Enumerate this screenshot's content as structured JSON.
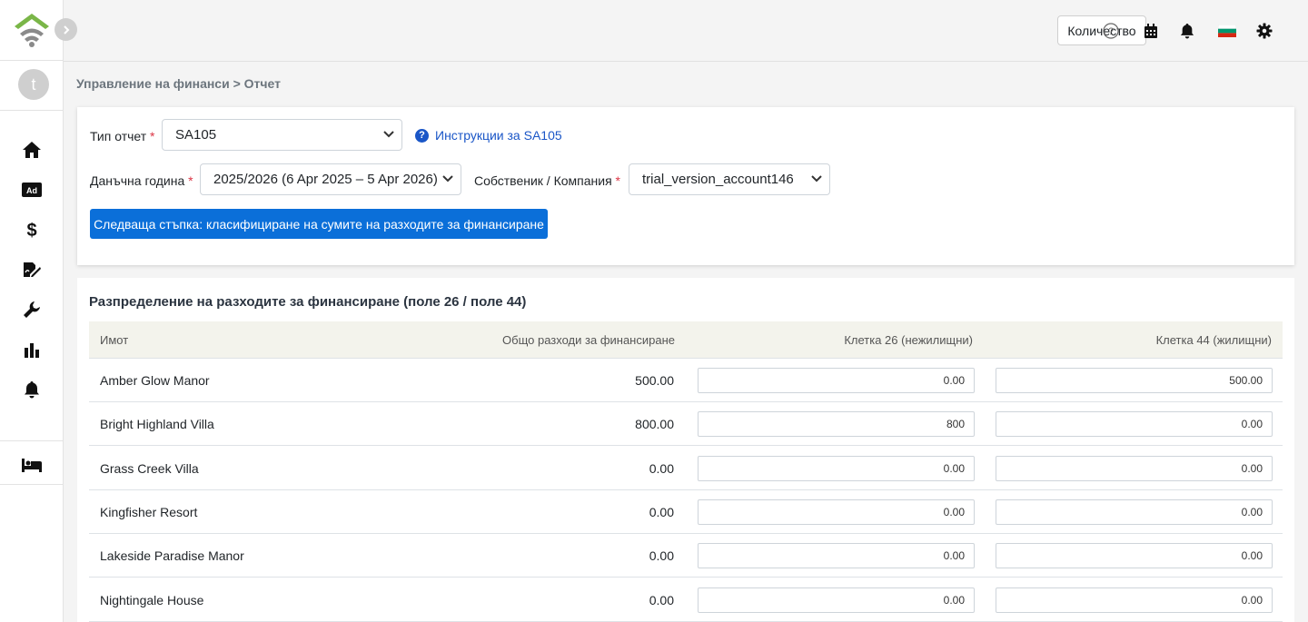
{
  "brand": {
    "logo_icon": "wifi-house-logo",
    "accent": "#7ab648"
  },
  "user": {
    "avatar_initial": "t"
  },
  "sidebar": {
    "items": [
      {
        "icon": "home-icon"
      },
      {
        "icon": "ad-icon"
      },
      {
        "icon": "dollar-icon"
      },
      {
        "icon": "signature-icon"
      },
      {
        "icon": "wrench-icon"
      },
      {
        "icon": "bar-chart-icon"
      },
      {
        "icon": "bell-icon"
      },
      {
        "icon": "bed-icon"
      }
    ]
  },
  "topbar": {
    "quantity_label": "Количество",
    "icons": [
      "help-icon",
      "calendar-icon",
      "bell-icon",
      "flag-bg-icon",
      "gear-icon"
    ]
  },
  "breadcrumb": {
    "text": "Управление на финанси > Отчет"
  },
  "form": {
    "report_type_label": "Тип отчет",
    "report_type_value": "SA105",
    "instructions_link": "Инструкции за SA105",
    "tax_year_label": "Данъчна година",
    "tax_year_value": "2025/2026 (6 Apr 2025 – 5 Apr 2026)",
    "owner_label": "Собственик / Компания",
    "owner_value": "trial_version_account146",
    "required_mark": "*",
    "next_button": "Следваща стъпка: класифициране на сумите на разходите за финансиране"
  },
  "table": {
    "title": "Разпределение на разходите за финансиране (поле 26 / поле 44)",
    "headers": [
      "Имот",
      "Общо разходи за финансиране",
      "Клетка 26 (нежилищни)",
      "Клетка 44 (жилищни)"
    ],
    "rows": [
      {
        "property": "Amber Glow Manor",
        "total": "500.00",
        "box26": "0.00",
        "box44": "500.00"
      },
      {
        "property": "Bright Highland Villa",
        "total": "800.00",
        "box26": "800",
        "box44": "0.00"
      },
      {
        "property": "Grass Creek Villa",
        "total": "0.00",
        "box26": "0.00",
        "box44": "0.00"
      },
      {
        "property": "Kingfisher Resort",
        "total": "0.00",
        "box26": "0.00",
        "box44": "0.00"
      },
      {
        "property": "Lakeside Paradise Manor",
        "total": "0.00",
        "box26": "0.00",
        "box44": "0.00"
      },
      {
        "property": "Nightingale House",
        "total": "0.00",
        "box26": "0.00",
        "box44": "0.00"
      }
    ]
  }
}
